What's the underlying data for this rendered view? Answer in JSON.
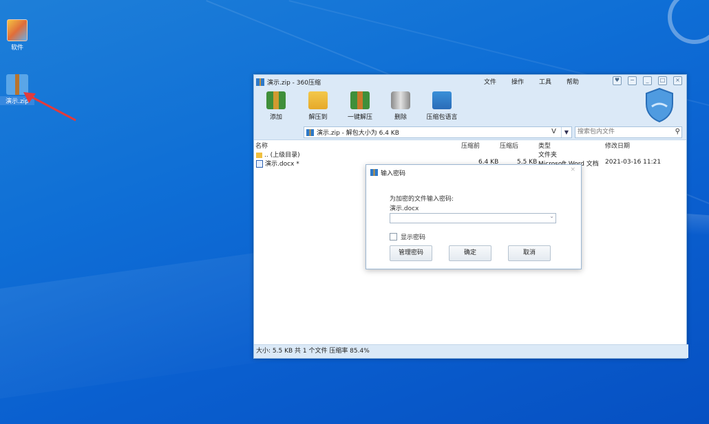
{
  "desktop": {
    "icons": [
      {
        "label": "软件"
      },
      {
        "label": "演示.zip"
      }
    ]
  },
  "window": {
    "title": "演示.zip - 360压缩",
    "menus": [
      "文件",
      "操作",
      "工具",
      "帮助"
    ],
    "toolbar": [
      {
        "label": "添加",
        "icon": "add-archive-icon"
      },
      {
        "label": "解压到",
        "icon": "extract-to-icon"
      },
      {
        "label": "一键解压",
        "icon": "one-click-extract-icon"
      },
      {
        "label": "删除",
        "icon": "delete-trash-icon"
      },
      {
        "label": "压缩包语言",
        "icon": "archive-language-icon"
      }
    ],
    "address": "演示.zip - 解包大小为 6.4 KB",
    "address_v": "V",
    "search_placeholder": "搜索包内文件",
    "columns": {
      "name": "名称",
      "before": "压缩前",
      "after": "压缩后",
      "type": "类型",
      "modified": "修改日期"
    },
    "rows": [
      {
        "name": ".. (上级目录)",
        "before": "",
        "after": "",
        "type": "文件夹",
        "modified": ""
      },
      {
        "name": "演示.docx *",
        "before": "6.4 KB",
        "after": "5.5 KB",
        "type": "Microsoft Word 文档",
        "modified": "2021-03-16 11:21"
      }
    ],
    "status": "大小: 5.5 KB 共 1 个文件 压缩率 85.4%"
  },
  "dialog": {
    "title": "输入密码",
    "prompt": "为加密的文件输入密码:",
    "filename": "演示.docx",
    "password_value": "",
    "show_password_label": "显示密码",
    "buttons": {
      "manage": "管理密码",
      "ok": "确定",
      "cancel": "取消"
    }
  },
  "colors": {
    "desktop": "#0f6fd6",
    "chrome": "#dbe9f7",
    "arrow": "#e23b3b"
  }
}
